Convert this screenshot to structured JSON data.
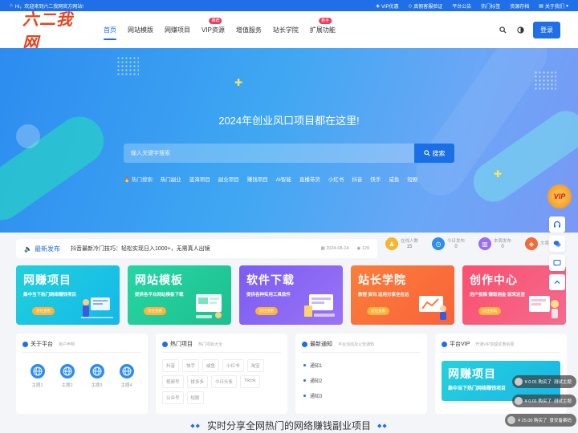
{
  "topbar": {
    "welcome": "Hi，欢迎来到六二我网官方网站!",
    "links": [
      "VIP优惠",
      "真假客服验证",
      "平台公告",
      "热门标签",
      "资源存档",
      "关于我们"
    ]
  },
  "header": {
    "logo": "六二我网",
    "nav": [
      {
        "label": "首页",
        "badge": ""
      },
      {
        "label": "网站模版",
        "badge": ""
      },
      {
        "label": "网赚项目",
        "badge": ""
      },
      {
        "label": "VIP资源",
        "badge": "推荐"
      },
      {
        "label": "增值服务",
        "badge": ""
      },
      {
        "label": "站长学院",
        "badge": ""
      },
      {
        "label": "扩展功能",
        "badge": "新手"
      }
    ],
    "login": "登录"
  },
  "hero": {
    "title": "2024年创业风口项目都在这里!",
    "search_placeholder": "输入关键字搜索",
    "search_button": "搜索",
    "hot_label": "热门搜索:",
    "hot_tags": [
      "热门副业",
      "蓝海项目",
      "副业项目",
      "赚钱项目",
      "AI智能",
      "直播带货",
      "小红书",
      "抖音",
      "快手",
      "咸鱼",
      "短剧"
    ]
  },
  "notice": {
    "tag": "最新发布",
    "text": "抖音最新冷门技巧：轻松实现日入1000+，无需真人出镜",
    "date": "2024-08-14",
    "views": "129"
  },
  "stats": [
    {
      "label": "在线人数",
      "value": "15",
      "color": "#f5b52c"
    },
    {
      "label": "今日发布",
      "value": "0",
      "color": "#2d8cf0"
    },
    {
      "label": "本周发布",
      "value": "0",
      "color": "#9b6cf5"
    },
    {
      "label": "文章",
      "value": "",
      "color": "#f06a3a"
    }
  ],
  "cards": [
    {
      "title": "网赚项目",
      "sub": "集中当下热门网络赚钱项目",
      "btn": "前往查看",
      "bg": "linear-gradient(135deg,#20d1dc,#15b8e8)"
    },
    {
      "title": "网站模板",
      "sub": "提供各平台网站模板下载",
      "btn": "前往查看",
      "bg": "linear-gradient(135deg,#25d6a4,#1fbf8f)"
    },
    {
      "title": "软件下载",
      "sub": "提供各种实用工具软件",
      "btn": "前往查看",
      "bg": "linear-gradient(135deg,#7b5cf2,#9a74f6)"
    },
    {
      "title": "站长学院",
      "sub": "教程 资讯 运用分享全在这",
      "btn": "前往查看",
      "bg": "linear-gradient(135deg,#fb7e3a,#f9623a)"
    },
    {
      "title": "创作中心",
      "sub": "用户投稿 赚取佣金 就来这里",
      "btn": "前往投稿",
      "bg": "linear-gradient(135deg,#fb4f6e,#f46b8f)"
    }
  ],
  "panels": {
    "about": {
      "title": "关于平台",
      "sub": "用户声明",
      "items": [
        "主题1",
        "主题2",
        "主题3",
        "主题4"
      ]
    },
    "hot": {
      "title": "热门项目",
      "sub": "热门项目大全",
      "tags": [
        "抖音",
        "快手",
        "咸鱼",
        "小红书",
        "淘宝",
        "视频号",
        "拼多多",
        "今日头条",
        "Tiktok",
        "公众号",
        "短剧"
      ]
    },
    "news": {
      "title": "最新通知",
      "sub": "平台活动及公告通知",
      "items": [
        "通知1",
        "通知2",
        "通知3"
      ]
    },
    "vip": {
      "title": "平台VIP",
      "sub": "开通VIP享超优惠资源",
      "banner_title": "网赚项目",
      "banner_sub": "集中当下热门网络赚钱项目"
    }
  },
  "bottom_title": "实时分享全网热门的网络赚钱副业项目",
  "toasts": [
    {
      "price": "¥ 0.01 购买了",
      "item": "测试主题"
    },
    {
      "price": "¥ 0.01 购买了",
      "item": "测试主题"
    },
    {
      "price": "¥ 25.00 购买了",
      "item": "景安备案码"
    }
  ],
  "vip_float": "VIP"
}
